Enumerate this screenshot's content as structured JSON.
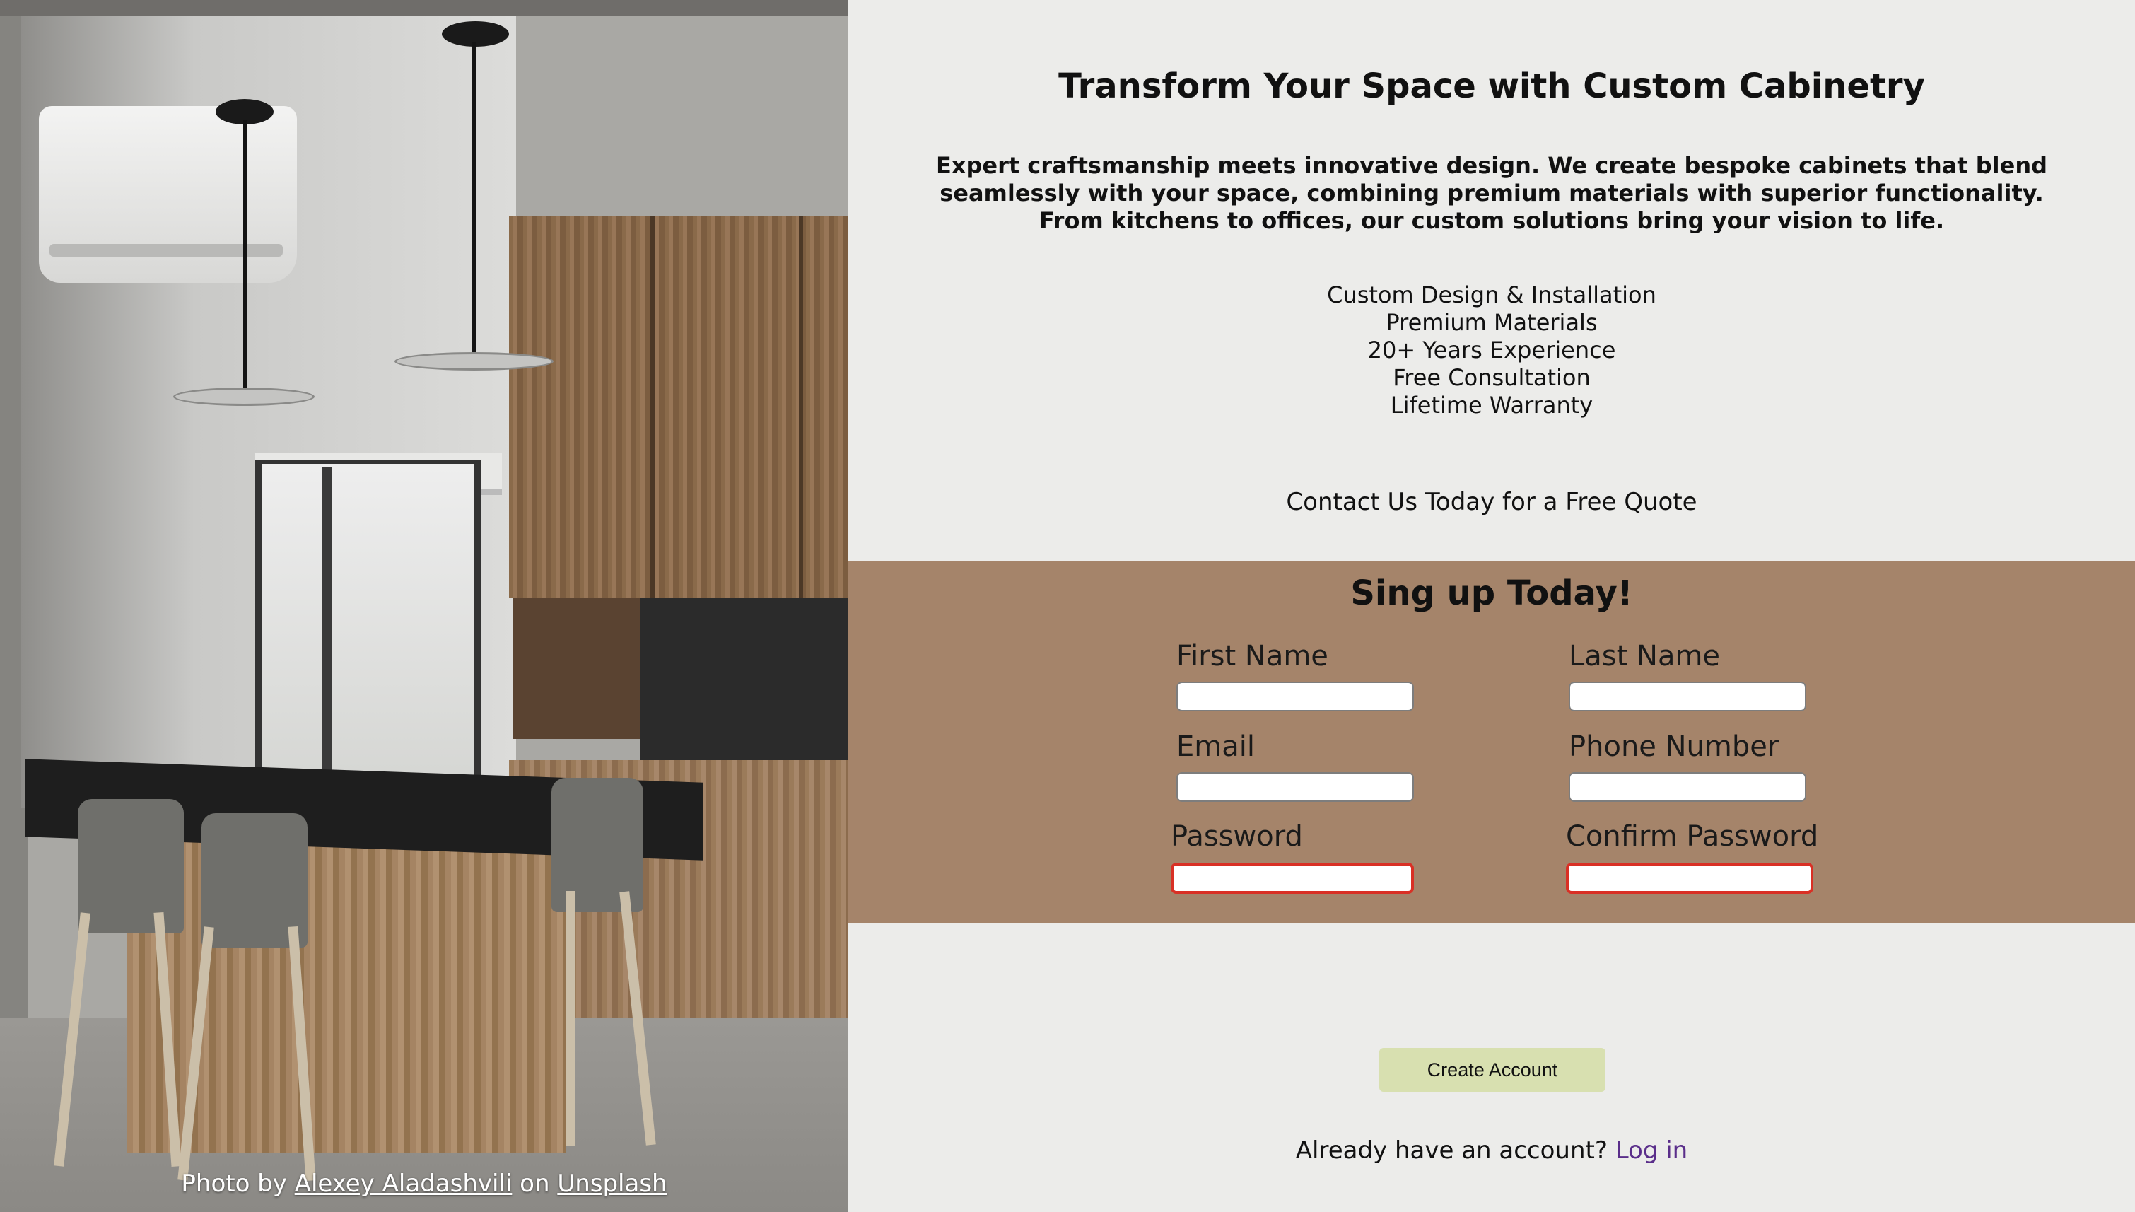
{
  "photo": {
    "credit_prefix": "Photo by",
    "author": "Alexey Aladashvili",
    "credit_middle": "on",
    "source": "Unsplash"
  },
  "hero": {
    "headline": "Transform Your Space with Custom Cabinetry",
    "intro": "Expert craftsmanship meets innovative design. We create bespoke cabinets that blend seamlessly with your space, combining premium materials with superior functionality. From kitchens to offices, our custom solutions bring your vision to life.",
    "features": [
      "Custom Design & Installation",
      "Premium Materials",
      "20+ Years Experience",
      "Free Consultation",
      "Lifetime Warranty"
    ],
    "cta": "Contact Us Today for a Free Quote"
  },
  "signup": {
    "title": "Sing up Today!",
    "first_name_label": "First Name",
    "last_name_label": "Last Name",
    "email_label": "Email",
    "phone_label": "Phone Number",
    "password_label": "Password",
    "confirm_password_label": "Confirm Password",
    "first_name_value": "",
    "last_name_value": "",
    "email_value": "",
    "phone_value": "",
    "password_value": "",
    "confirm_password_value": "",
    "submit_label": "Create Account",
    "login_prompt": "Already have an account?",
    "login_link": "Log in"
  },
  "colors": {
    "page_background": "#ececea",
    "form_background": "#a5846a",
    "button_background": "#d8e0b0",
    "invalid_border": "#d93025",
    "link": "#5a2e8a"
  }
}
